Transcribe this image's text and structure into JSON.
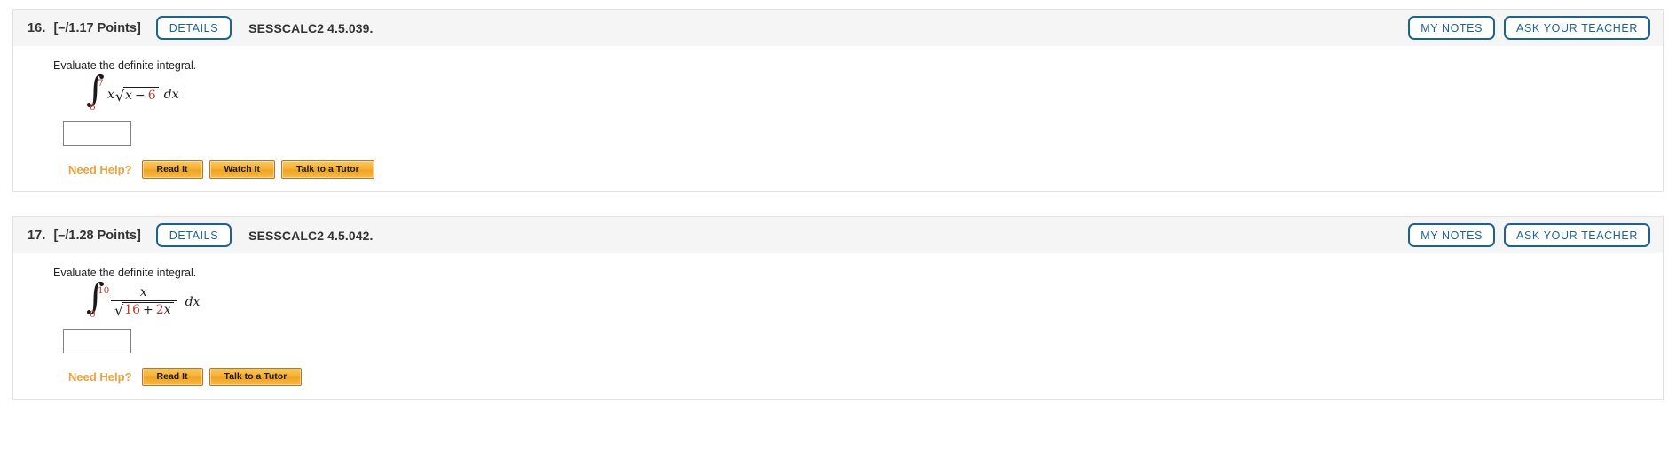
{
  "questions": [
    {
      "number": "16.",
      "points": "[–/1.17 Points]",
      "details_label": "DETAILS",
      "source": "SESSCALC2 4.5.039.",
      "my_notes_label": "MY NOTES",
      "ask_teacher_label": "ASK YOUR TEACHER",
      "prompt": "Evaluate the definite integral.",
      "math": {
        "integral_symbol": "∫",
        "upper_limit": "7",
        "lower_limit": "6",
        "integrand_leading_var": "x",
        "radical_symbol": "√",
        "radicand_var": "x",
        "radicand_operator": "−",
        "radicand_number": "6",
        "differential": "dx"
      },
      "answer_value": "",
      "answer_placeholder": "",
      "need_help_label": "Need Help?",
      "help_buttons": [
        "Read It",
        "Watch It",
        "Talk to a Tutor"
      ]
    },
    {
      "number": "17.",
      "points": "[–/1.28 Points]",
      "details_label": "DETAILS",
      "source": "SESSCALC2 4.5.042.",
      "my_notes_label": "MY NOTES",
      "ask_teacher_label": "ASK YOUR TEACHER",
      "prompt": "Evaluate the definite integral.",
      "math": {
        "integral_symbol": "∫",
        "upper_limit": "10",
        "lower_limit": "0",
        "numerator_var": "x",
        "radical_symbol": "√",
        "denominator_number": "16",
        "denominator_operator": "+",
        "denominator_coefficient": "2",
        "denominator_var": "x",
        "differential": "dx"
      },
      "answer_value": "",
      "answer_placeholder": "",
      "need_help_label": "Need Help?",
      "help_buttons": [
        "Read It",
        "Talk to a Tutor"
      ]
    }
  ],
  "colors": {
    "accent_blue": "#1b6490",
    "help_orange": "#e8a33d",
    "math_red": "#c0392b",
    "header_bg": "#f5f5f5"
  }
}
